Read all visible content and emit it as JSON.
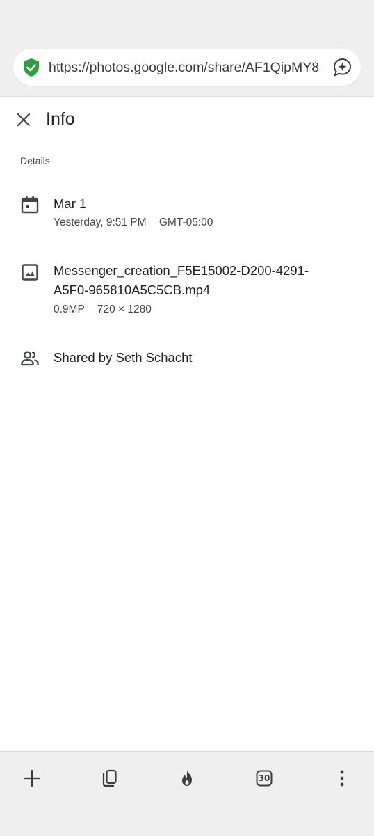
{
  "browser": {
    "url": "https://photos.google.com/share/AF1QipMY8",
    "icons": {
      "security": "shield-check-icon",
      "assistant": "sparkle-chat-icon"
    },
    "colors": {
      "shield": "#2e9e41"
    }
  },
  "panel": {
    "title": "Info",
    "close_icon": "close-icon",
    "section_label": "Details"
  },
  "details": {
    "date": {
      "icon": "calendar-icon",
      "primary": "Mar 1",
      "time": "Yesterday, 9:51 PM",
      "timezone": "GMT-05:00"
    },
    "file": {
      "icon": "image-icon",
      "name_line1": "Messenger_creation_F5E15002-D200-4291-",
      "name_line2": "A5F0-965810A5C5CB.mp4",
      "megapixels": "0.9MP",
      "dimensions": "720 × 1280"
    },
    "shared": {
      "icon": "people-icon",
      "text": "Shared by Seth Schacht"
    }
  },
  "bottom_nav": {
    "new_tab_icon": "plus-icon",
    "tabs_icon": "tab-switcher-icon",
    "burn_icon": "fire-icon",
    "tab_count": "30",
    "menu_icon": "more-vert-icon"
  }
}
